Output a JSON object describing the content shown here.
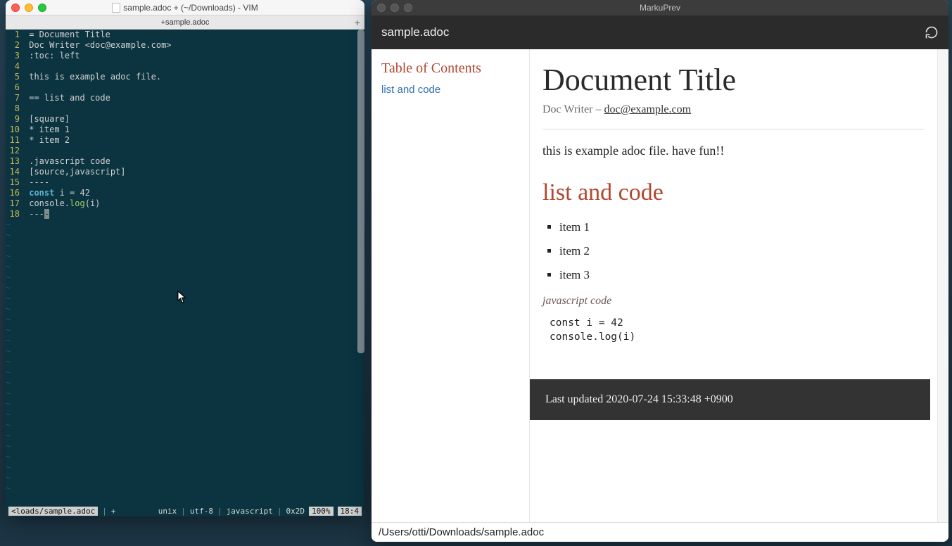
{
  "vim": {
    "window_title": "sample.adoc + (~/Downloads) - VIM",
    "tab_label": "+sample.adoc",
    "lines": [
      {
        "n": 1,
        "html": "= Document Title"
      },
      {
        "n": 2,
        "html": "Doc Writer &lt;doc@example.com&gt;"
      },
      {
        "n": 3,
        "html": ":toc: left"
      },
      {
        "n": 4,
        "html": ""
      },
      {
        "n": 5,
        "html": "this is example adoc file."
      },
      {
        "n": 6,
        "html": ""
      },
      {
        "n": 7,
        "html": "== list and code"
      },
      {
        "n": 8,
        "html": ""
      },
      {
        "n": 9,
        "html": "[square]"
      },
      {
        "n": 10,
        "html": "* item 1"
      },
      {
        "n": 11,
        "html": "* item 2"
      },
      {
        "n": 12,
        "html": ""
      },
      {
        "n": 13,
        "html": ".javascript code"
      },
      {
        "n": 14,
        "html": "[source,javascript]"
      },
      {
        "n": 15,
        "html": "----"
      },
      {
        "n": 16,
        "html": "<span class='kw'>const</span> i = 42"
      },
      {
        "n": 17,
        "html": "console.<span class='fn'>log</span>(i)"
      },
      {
        "n": 18,
        "html": "---<span class='cursor-block'>-</span>"
      }
    ],
    "tilde_rows": 26,
    "status": {
      "file": "<loads/sample.adoc",
      "modified": "+",
      "fmt": "unix",
      "enc": "utf-8",
      "ft": "javascript",
      "hex": "0x2D",
      "pct": "100%",
      "cursor": "18:4"
    }
  },
  "prev": {
    "app_title": "MarkuPrev",
    "filename": "sample.adoc",
    "toc_title": "Table of Contents",
    "toc_items": [
      "list and code"
    ],
    "doc_title": "Document Title",
    "author_prefix": "Doc Writer – ",
    "author_email": "doc@example.com",
    "intro": "this is example adoc file. have fun!!",
    "section_heading": "list and code",
    "list_items": [
      "item 1",
      "item 2",
      "item 3"
    ],
    "code_caption": "javascript code",
    "code_lines": [
      "const i = 42",
      "console.log(i)"
    ],
    "footer": "Last updated 2020-07-24 15:33:48 +0900",
    "path": "/Users/otti/Downloads/sample.adoc"
  }
}
